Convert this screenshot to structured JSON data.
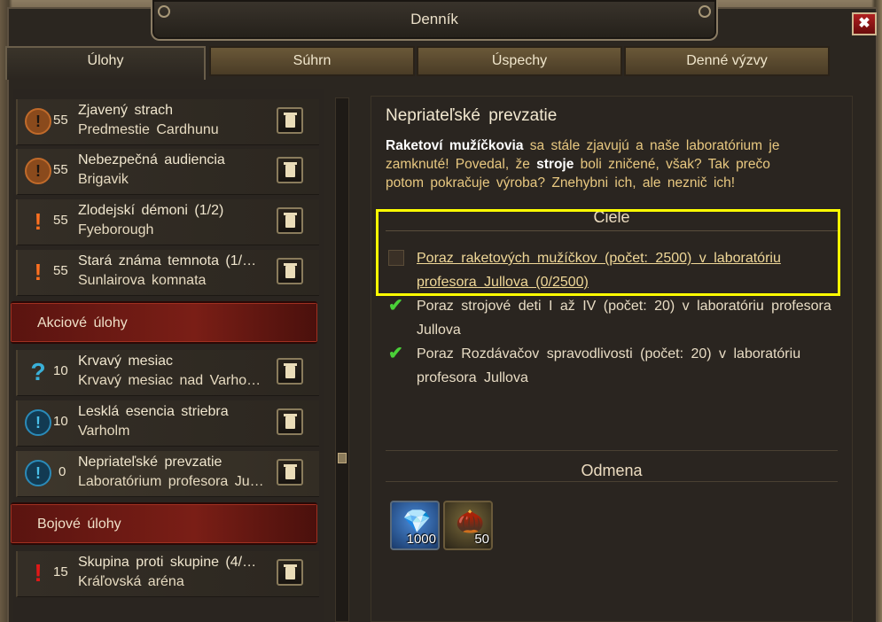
{
  "window": {
    "title": "Denník",
    "close_label": "✖"
  },
  "tabs": [
    {
      "label": "Úlohy",
      "active": true
    },
    {
      "label": "Súhrn",
      "active": false
    },
    {
      "label": "Úspechy",
      "active": false
    },
    {
      "label": "Denné výzvy",
      "active": false
    }
  ],
  "quest_list": {
    "quests_top": [
      {
        "icon": "orange-circle-exclamation-icon",
        "level": "55",
        "name": "Zjavený strach",
        "location": "Predmestie Cardhunu"
      },
      {
        "icon": "orange-circle-exclamation-icon",
        "level": "55",
        "name": "Nebezpečná audiencia",
        "location": "Brigavik"
      },
      {
        "icon": "orange-exclamation-icon",
        "level": "55",
        "name": "Zlodejskí démoni (1/2)",
        "location": "Fyeborough"
      },
      {
        "icon": "orange-exclamation-icon",
        "level": "55",
        "name": "Stará známa temnota (1/…",
        "location": "Sunlairova komnata"
      }
    ],
    "category_action": "Akciové úlohy",
    "quests_action": [
      {
        "icon": "blue-question-icon",
        "level": "10",
        "name": "Krvavý mesiac",
        "location": "Krvavý mesiac nad Varho…"
      },
      {
        "icon": "blue-circle-exclamation-icon",
        "level": "10",
        "name": "Lesklá esencia striebra",
        "location": "Varholm"
      },
      {
        "icon": "blue-circle-exclamation-icon",
        "level": "0",
        "name": "Nepriateľské prevzatie",
        "location": "Laboratórium profesora Ju…"
      }
    ],
    "category_combat": "Bojové úlohy",
    "quests_combat": [
      {
        "icon": "red-exclamation-icon",
        "level": "15",
        "name": "Skupina proti skupine (4/…",
        "location": "Kráľovská aréna"
      }
    ]
  },
  "detail": {
    "title": "Nepriateľské prevzatie",
    "desc_bold1": "Raketoví mužíčkovia",
    "desc_part1": " sa stále zjavujú a naše laboratórium je zamknuté! Povedal, že ",
    "desc_bold2": "stroje",
    "desc_part2": " boli zničené, však? Tak prečo potom pokračuje výroba? Znehybni ich, ale neznič ich!",
    "goals_header": "Ciele",
    "goals": [
      {
        "text": "Poraz raketových mužíčkov (počet: 2500) v laboratóriu profesora Jullova (0/2500)",
        "done": false
      },
      {
        "text": "Poraz strojové deti I až IV (počet: 20) v laboratóriu profesora Jullova",
        "done": true
      },
      {
        "text": "Poraz Rozdávačov spravodlivosti (počet: 20) v laboratóriu profesora Jullova",
        "done": true
      }
    ],
    "reward_header": "Odmena",
    "rewards": [
      {
        "icon": "gems-icon",
        "count": "1000"
      },
      {
        "icon": "acorn-icon",
        "count": "50"
      }
    ]
  },
  "colors": {
    "highlight": "#ffff00",
    "category_red": "#7a1e16",
    "check_green": "#4ad038"
  }
}
